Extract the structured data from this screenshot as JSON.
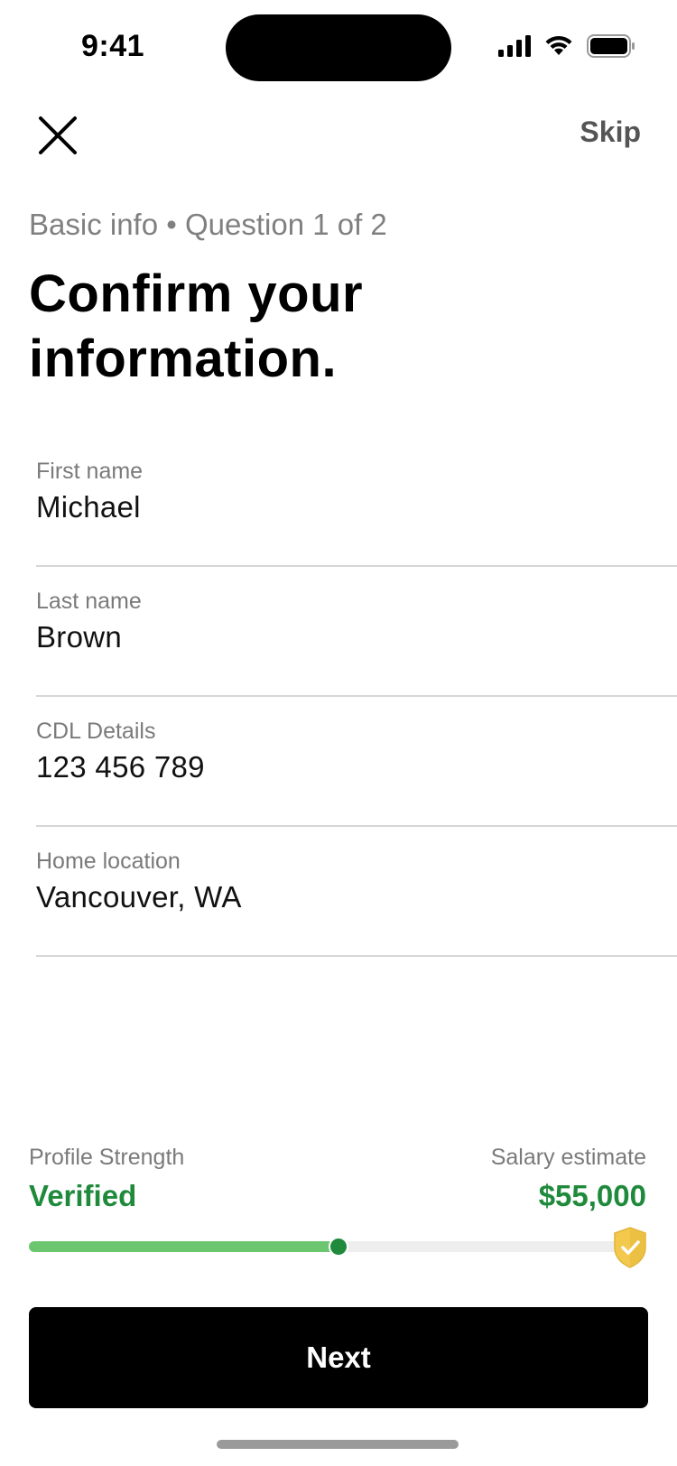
{
  "status_bar": {
    "time": "9:41"
  },
  "nav": {
    "skip_label": "Skip"
  },
  "header": {
    "progress_caption": "Basic info • Question 1 of 2",
    "title": "Confirm your information."
  },
  "fields": [
    {
      "label": "First name",
      "value": "Michael"
    },
    {
      "label": "Last name",
      "value": "Brown"
    },
    {
      "label": "CDL Details",
      "value": "123 456 789"
    },
    {
      "label": "Home location",
      "value": "Vancouver, WA"
    }
  ],
  "footer": {
    "strength_label": "Profile Strength",
    "strength_value": "Verified",
    "salary_label": "Salary estimate",
    "salary_value": "$55,000",
    "progress_fraction": 0.52,
    "next_label": "Next"
  },
  "colors": {
    "accent_green": "#1f8a3b",
    "progress_fill": "#6cc56f",
    "shield_gold": "#f2c94c"
  },
  "icons": {
    "close": "close-icon",
    "shield": "shield-check-icon",
    "signal": "cellular-signal-icon",
    "wifi": "wifi-icon",
    "battery": "battery-icon"
  }
}
